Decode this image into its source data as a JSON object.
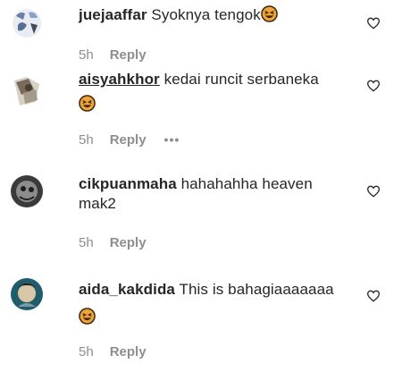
{
  "comments": [
    {
      "username": "juejaaffar",
      "text": "Syoknya tengok",
      "time": "5h",
      "reply": "Reply"
    },
    {
      "username": "aisyahkhor",
      "text": "kedai runcit serbaneka",
      "time": "5h",
      "reply": "Reply",
      "more": "•••"
    },
    {
      "username": "cikpuanmaha",
      "text": "hahahahha heaven",
      "text_line2": "mak2",
      "time": "5h",
      "reply": "Reply"
    },
    {
      "username": "aida_kakdida",
      "text": "This is bahagiaaaaaaa",
      "time": "5h",
      "reply": "Reply"
    }
  ],
  "colors": {
    "text": "#262626",
    "secondary": "#8e8e8e",
    "emoji_face": "#f2a33a"
  },
  "icons": {
    "like": "heart-outline-icon",
    "emoji": "grinning-squinting-face-emoji"
  }
}
